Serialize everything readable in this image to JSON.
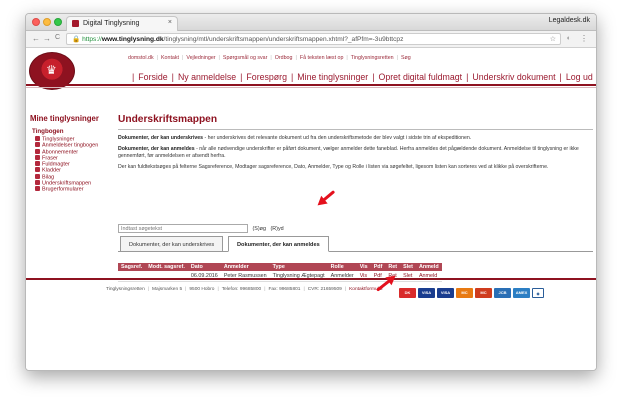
{
  "browser": {
    "tab_title": "Digital Tinglysning",
    "tab_close": "×",
    "profile": "Legaldesk.dk",
    "nav_back": "←",
    "nav_forward": "→",
    "nav_reload": "C",
    "url_lock": "🔒",
    "url_scheme": "https://",
    "url_host": "www.tinglysning.dk",
    "url_path": "/tinglysning/mtl/underskriftsmappen/underskriftsmappen.xhtml?_afPfm=-3u9bttcpz",
    "star": "☆",
    "ext": "◐",
    "menu": "⋮"
  },
  "toplinks": [
    "domstol.dk",
    "Kontakt",
    "Vejledninger",
    "Spørgsmål og svar",
    "Ordbog",
    "Få teksten læst op",
    "Tinglysningsretten",
    "Søg"
  ],
  "mainnav": [
    "Forside",
    "Ny anmeldelse",
    "Forespørg",
    "Mine tinglysninger",
    "Opret digital fuldmagt",
    "Underskriv dokument",
    "Log ud"
  ],
  "sidebar": {
    "title": "Mine tinglysninger",
    "heading": "Tingbogen",
    "items": [
      "Tinglysninger",
      "Anmeldelser tingbogen",
      "Abonnementer",
      "Fraser",
      "Fuldmagter",
      "Kladder",
      "Bilag",
      "Underskriftsmappen",
      "Brugerformularer"
    ]
  },
  "content": {
    "title": "Underskriftsmappen",
    "p1_bold": "Dokumenter, der kan underskrives",
    "p1_rest": " - her underskrives det relevante dokument ud fra den underskriftsmetode der blev valgt i sidste trin af ekspeditionen.",
    "p2_bold": "Dokumenter, der kan anmeldes",
    "p2_rest": " - når alle nødvendige underskrifter er påført dokument, vælger anmelder dette fanebIad. Herfra anmeldes det pågældende dokument. Anmeldelse til tinglysning er ikke gennemført, før anmeldelsen er afsendt herfra.",
    "p3": "Der kan fuldtekstsøges på felterne Sagsreference, Modtager sagsreference, Dato, Anmelder, Type og Rolle i listen via søgefeltet, ligesom listen kan sorteres ved at klikke på overskrifterne.",
    "search_placeholder": "Indtast søgetekst",
    "search_btn": "(S)øg",
    "reset_btn": "(R)yd",
    "tabs": [
      "Dokumenter, der kan underskrives",
      "Dokumenter, der kan anmeldes"
    ]
  },
  "table": {
    "headers": [
      "Sagsref.",
      "Modt. sagsref.",
      "Dato",
      "Anmelder",
      "Type",
      "Rolle",
      "Vis",
      "Pdf",
      "Ret",
      "Slet",
      "Anmeld"
    ],
    "row": [
      "",
      "",
      "06.09.2016",
      "Peter Rasmussen",
      "Tinglysning Ægtepagt",
      "Anmelder",
      "Vis",
      "Pdf",
      "Ret",
      "Slet",
      "Anmeld"
    ]
  },
  "footer": [
    "Tinglysningsretten",
    "Majsmarken 5",
    "9500 Hobro",
    "Telefon: 99685800",
    "Fax: 99685801",
    "CVR: 21659509",
    "Kontaktformular"
  ],
  "cards": [
    {
      "label": "DK",
      "color": "#d92b2b"
    },
    {
      "label": "VISA",
      "color": "#1a3d8f"
    },
    {
      "label": "VISA",
      "color": "#1a3d8f"
    },
    {
      "label": "MC",
      "color": "#e87a12"
    },
    {
      "label": "MC",
      "color": "#cf3c1e"
    },
    {
      "label": "JCB",
      "color": "#2a6fb5"
    },
    {
      "label": "AMEX",
      "color": "#2c7fc4"
    }
  ],
  "colors": {
    "brand": "#8e1220",
    "arrow": "#e4101d"
  }
}
